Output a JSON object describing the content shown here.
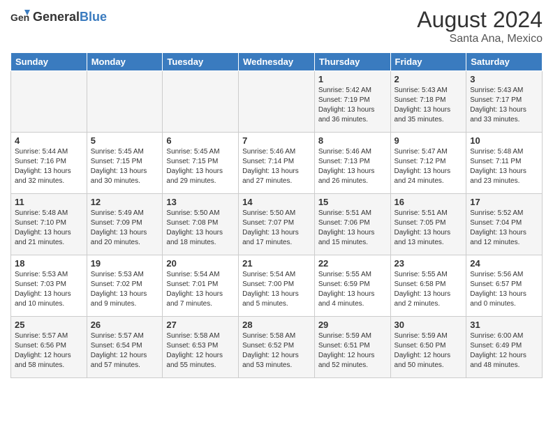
{
  "header": {
    "logo_general": "General",
    "logo_blue": "Blue",
    "month_year": "August 2024",
    "location": "Santa Ana, Mexico"
  },
  "days_of_week": [
    "Sunday",
    "Monday",
    "Tuesday",
    "Wednesday",
    "Thursday",
    "Friday",
    "Saturday"
  ],
  "weeks": [
    [
      {
        "day": "",
        "sunrise": "",
        "sunset": "",
        "daylight": ""
      },
      {
        "day": "",
        "sunrise": "",
        "sunset": "",
        "daylight": ""
      },
      {
        "day": "",
        "sunrise": "",
        "sunset": "",
        "daylight": ""
      },
      {
        "day": "",
        "sunrise": "",
        "sunset": "",
        "daylight": ""
      },
      {
        "day": "1",
        "sunrise": "Sunrise: 5:42 AM",
        "sunset": "Sunset: 7:19 PM",
        "daylight": "Daylight: 13 hours and 36 minutes."
      },
      {
        "day": "2",
        "sunrise": "Sunrise: 5:43 AM",
        "sunset": "Sunset: 7:18 PM",
        "daylight": "Daylight: 13 hours and 35 minutes."
      },
      {
        "day": "3",
        "sunrise": "Sunrise: 5:43 AM",
        "sunset": "Sunset: 7:17 PM",
        "daylight": "Daylight: 13 hours and 33 minutes."
      }
    ],
    [
      {
        "day": "4",
        "sunrise": "Sunrise: 5:44 AM",
        "sunset": "Sunset: 7:16 PM",
        "daylight": "Daylight: 13 hours and 32 minutes."
      },
      {
        "day": "5",
        "sunrise": "Sunrise: 5:45 AM",
        "sunset": "Sunset: 7:15 PM",
        "daylight": "Daylight: 13 hours and 30 minutes."
      },
      {
        "day": "6",
        "sunrise": "Sunrise: 5:45 AM",
        "sunset": "Sunset: 7:15 PM",
        "daylight": "Daylight: 13 hours and 29 minutes."
      },
      {
        "day": "7",
        "sunrise": "Sunrise: 5:46 AM",
        "sunset": "Sunset: 7:14 PM",
        "daylight": "Daylight: 13 hours and 27 minutes."
      },
      {
        "day": "8",
        "sunrise": "Sunrise: 5:46 AM",
        "sunset": "Sunset: 7:13 PM",
        "daylight": "Daylight: 13 hours and 26 minutes."
      },
      {
        "day": "9",
        "sunrise": "Sunrise: 5:47 AM",
        "sunset": "Sunset: 7:12 PM",
        "daylight": "Daylight: 13 hours and 24 minutes."
      },
      {
        "day": "10",
        "sunrise": "Sunrise: 5:48 AM",
        "sunset": "Sunset: 7:11 PM",
        "daylight": "Daylight: 13 hours and 23 minutes."
      }
    ],
    [
      {
        "day": "11",
        "sunrise": "Sunrise: 5:48 AM",
        "sunset": "Sunset: 7:10 PM",
        "daylight": "Daylight: 13 hours and 21 minutes."
      },
      {
        "day": "12",
        "sunrise": "Sunrise: 5:49 AM",
        "sunset": "Sunset: 7:09 PM",
        "daylight": "Daylight: 13 hours and 20 minutes."
      },
      {
        "day": "13",
        "sunrise": "Sunrise: 5:50 AM",
        "sunset": "Sunset: 7:08 PM",
        "daylight": "Daylight: 13 hours and 18 minutes."
      },
      {
        "day": "14",
        "sunrise": "Sunrise: 5:50 AM",
        "sunset": "Sunset: 7:07 PM",
        "daylight": "Daylight: 13 hours and 17 minutes."
      },
      {
        "day": "15",
        "sunrise": "Sunrise: 5:51 AM",
        "sunset": "Sunset: 7:06 PM",
        "daylight": "Daylight: 13 hours and 15 minutes."
      },
      {
        "day": "16",
        "sunrise": "Sunrise: 5:51 AM",
        "sunset": "Sunset: 7:05 PM",
        "daylight": "Daylight: 13 hours and 13 minutes."
      },
      {
        "day": "17",
        "sunrise": "Sunrise: 5:52 AM",
        "sunset": "Sunset: 7:04 PM",
        "daylight": "Daylight: 13 hours and 12 minutes."
      }
    ],
    [
      {
        "day": "18",
        "sunrise": "Sunrise: 5:53 AM",
        "sunset": "Sunset: 7:03 PM",
        "daylight": "Daylight: 13 hours and 10 minutes."
      },
      {
        "day": "19",
        "sunrise": "Sunrise: 5:53 AM",
        "sunset": "Sunset: 7:02 PM",
        "daylight": "Daylight: 13 hours and 9 minutes."
      },
      {
        "day": "20",
        "sunrise": "Sunrise: 5:54 AM",
        "sunset": "Sunset: 7:01 PM",
        "daylight": "Daylight: 13 hours and 7 minutes."
      },
      {
        "day": "21",
        "sunrise": "Sunrise: 5:54 AM",
        "sunset": "Sunset: 7:00 PM",
        "daylight": "Daylight: 13 hours and 5 minutes."
      },
      {
        "day": "22",
        "sunrise": "Sunrise: 5:55 AM",
        "sunset": "Sunset: 6:59 PM",
        "daylight": "Daylight: 13 hours and 4 minutes."
      },
      {
        "day": "23",
        "sunrise": "Sunrise: 5:55 AM",
        "sunset": "Sunset: 6:58 PM",
        "daylight": "Daylight: 13 hours and 2 minutes."
      },
      {
        "day": "24",
        "sunrise": "Sunrise: 5:56 AM",
        "sunset": "Sunset: 6:57 PM",
        "daylight": "Daylight: 13 hours and 0 minutes."
      }
    ],
    [
      {
        "day": "25",
        "sunrise": "Sunrise: 5:57 AM",
        "sunset": "Sunset: 6:56 PM",
        "daylight": "Daylight: 12 hours and 58 minutes."
      },
      {
        "day": "26",
        "sunrise": "Sunrise: 5:57 AM",
        "sunset": "Sunset: 6:54 PM",
        "daylight": "Daylight: 12 hours and 57 minutes."
      },
      {
        "day": "27",
        "sunrise": "Sunrise: 5:58 AM",
        "sunset": "Sunset: 6:53 PM",
        "daylight": "Daylight: 12 hours and 55 minutes."
      },
      {
        "day": "28",
        "sunrise": "Sunrise: 5:58 AM",
        "sunset": "Sunset: 6:52 PM",
        "daylight": "Daylight: 12 hours and 53 minutes."
      },
      {
        "day": "29",
        "sunrise": "Sunrise: 5:59 AM",
        "sunset": "Sunset: 6:51 PM",
        "daylight": "Daylight: 12 hours and 52 minutes."
      },
      {
        "day": "30",
        "sunrise": "Sunrise: 5:59 AM",
        "sunset": "Sunset: 6:50 PM",
        "daylight": "Daylight: 12 hours and 50 minutes."
      },
      {
        "day": "31",
        "sunrise": "Sunrise: 6:00 AM",
        "sunset": "Sunset: 6:49 PM",
        "daylight": "Daylight: 12 hours and 48 minutes."
      }
    ]
  ]
}
